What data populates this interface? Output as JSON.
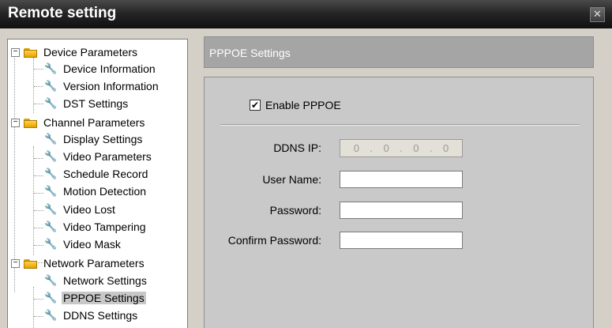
{
  "window": {
    "title": "Remote setting",
    "close_glyph": "✕"
  },
  "tree": {
    "groups": [
      {
        "label": "Device Parameters",
        "expander": "−"
      },
      {
        "label": "Channel Parameters",
        "expander": "−"
      },
      {
        "label": "Network Parameters",
        "expander": "−"
      }
    ],
    "items": [
      {
        "label": "Device Information"
      },
      {
        "label": "Version Information"
      },
      {
        "label": "DST Settings"
      },
      {
        "label": "Display Settings"
      },
      {
        "label": "Video Parameters"
      },
      {
        "label": "Schedule Record"
      },
      {
        "label": "Motion Detection"
      },
      {
        "label": "Video Lost"
      },
      {
        "label": "Video Tampering"
      },
      {
        "label": "Video Mask"
      },
      {
        "label": "Network Settings"
      },
      {
        "label": "PPPOE Settings",
        "selected": true
      },
      {
        "label": "DDNS Settings"
      }
    ]
  },
  "content": {
    "header": "PPPOE Settings",
    "enable_checkbox": {
      "label": "Enable PPPOE",
      "checked": true,
      "check_glyph": "✔"
    },
    "fields": {
      "ddns_ip": {
        "label": "DDNS IP:",
        "octets": [
          "0",
          ".",
          "0",
          ".",
          "0",
          ".",
          "0"
        ]
      },
      "user_name": {
        "label": "User Name:",
        "value": ""
      },
      "password": {
        "label": "Password:",
        "value": ""
      },
      "confirm_password": {
        "label": "Confirm Password:",
        "value": ""
      }
    }
  },
  "icons": {
    "folder": "folder-icon",
    "wrench": "wrench-icon",
    "expander": "minus-box-icon"
  }
}
